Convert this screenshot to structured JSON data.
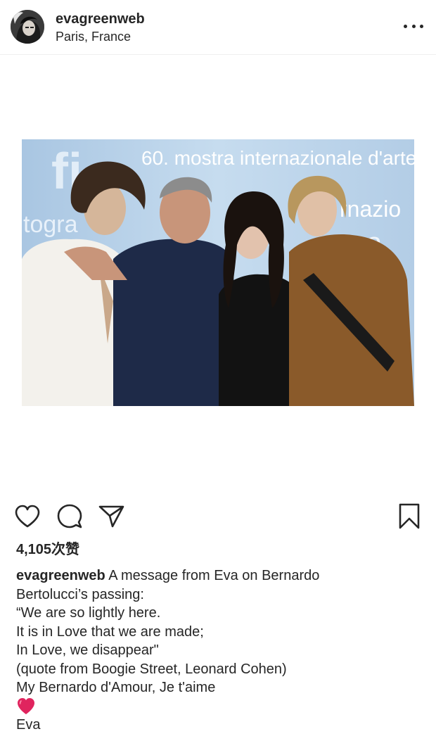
{
  "post": {
    "username": "evagreenweb",
    "location": "Paris, France",
    "photo_banner_text": "60. mostra internazionale d'arte"
  },
  "likes": {
    "count_text": "4,105次赞"
  },
  "caption": {
    "username": "evagreenweb",
    "first_line_text": "A message from Eva on Bernardo",
    "lines": [
      "Bertolucci’s passing:",
      "“We are so lightly here.",
      "It is in Love that we are made;",
      "In Love, we disappear\"",
      "(quote from Boogie Street, Leonard Cohen)",
      "My Bernardo d'Amour, Je t'aime"
    ],
    "emoji": "red-heart",
    "signature": "Eva"
  },
  "icons": {
    "more": "more-dots-icon",
    "like": "heart-icon",
    "comment": "comment-icon",
    "share": "paper-plane-icon",
    "save": "bookmark-icon"
  },
  "colors": {
    "text": "#262626",
    "divider": "#efefef",
    "heart_red": "#e0245e",
    "photo_backdrop": "#b9d3ea"
  }
}
